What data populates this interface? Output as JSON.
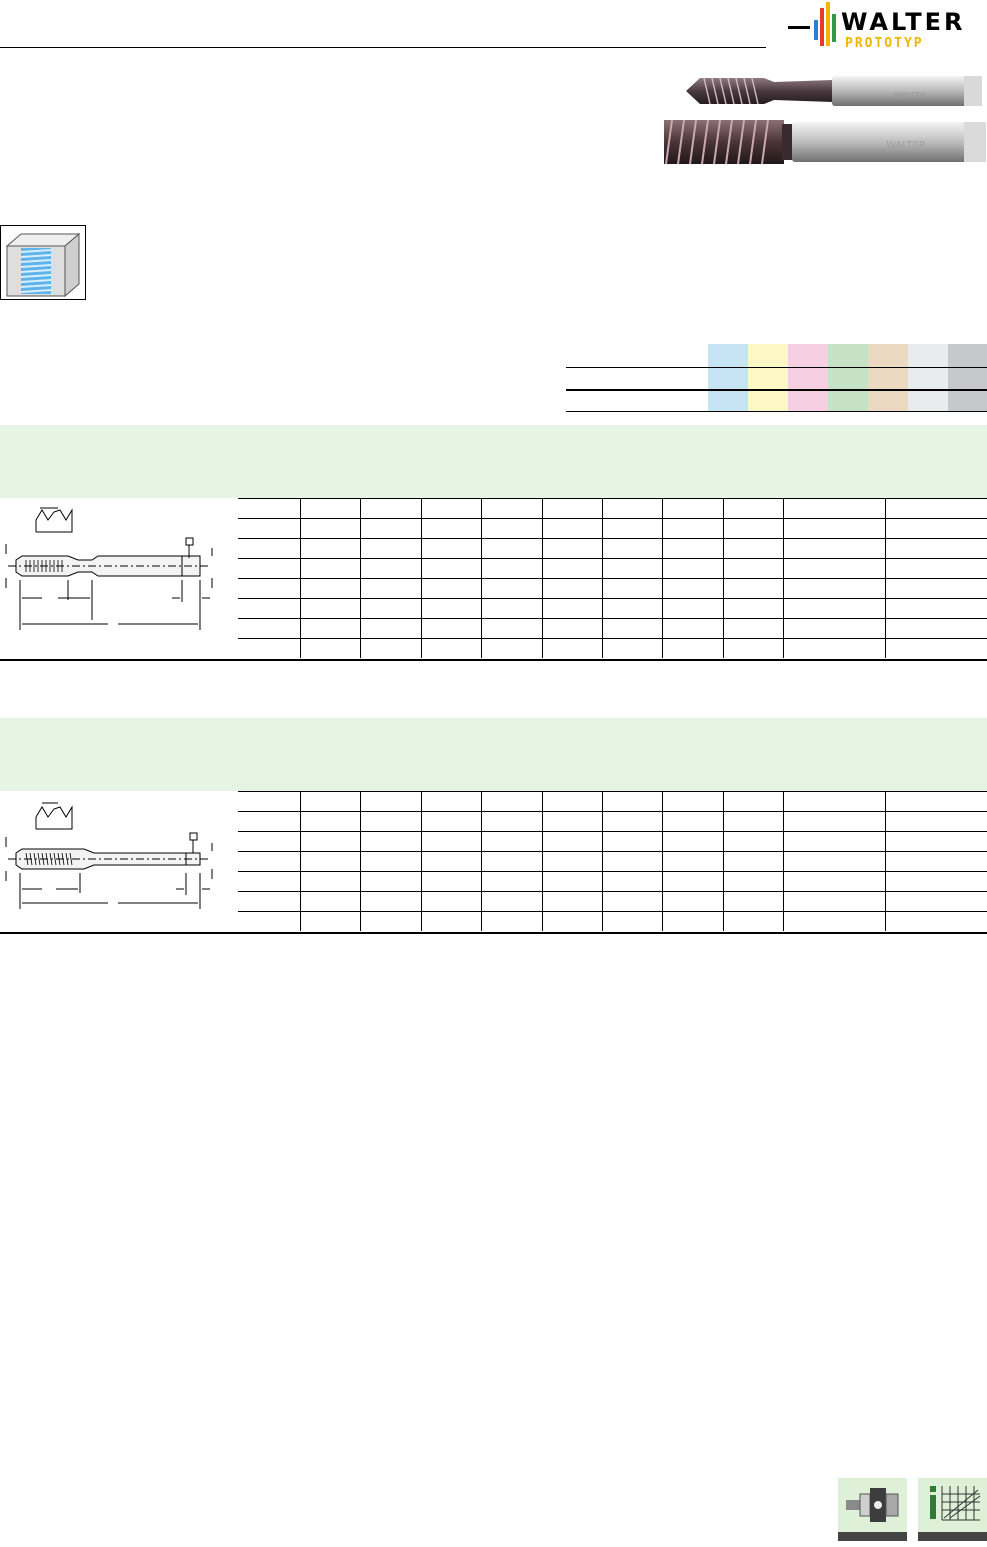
{
  "header": {
    "brand": "WALTER",
    "brand_sub": "PROTOTYP"
  },
  "colors": {
    "brand_yellow": "#f2b600",
    "band_green": "#e8f4e3",
    "material_groups": [
      "#c7e4f5",
      "#fbf8c6",
      "#f6cfe3",
      "#c6e2c6",
      "#ecd9c1",
      "#e9ecee",
      "#c7c8ca"
    ]
  },
  "icons": {
    "operation": "threaded-hole-icon",
    "tool_1": "spiral-point-tap-image",
    "tool_2": "spiral-flute-tap-image",
    "footer_left": "tap-holder-icon",
    "footer_right": "info-chart-icon"
  },
  "sections": [
    {
      "id": "section-1",
      "rows": 8,
      "cols": 12
    },
    {
      "id": "section-2",
      "rows": 7,
      "cols": 12
    }
  ]
}
